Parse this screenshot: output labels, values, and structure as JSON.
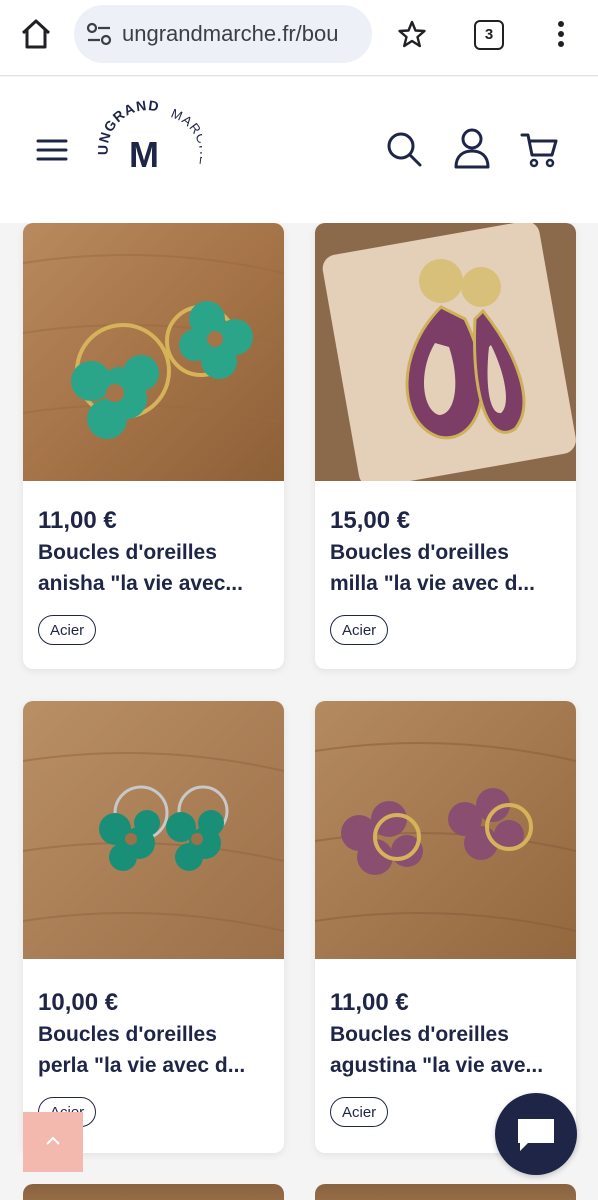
{
  "browser": {
    "url": "ungrandmarche.fr/bou",
    "tab_count": "3"
  },
  "brand": {
    "logo_top": "UNGRAND",
    "logo_side": "MARCHÉ",
    "logo_letter": "M",
    "primary_color": "#1f2547",
    "accent_color": "#f3b8ae"
  },
  "products": [
    {
      "price": "11,00 €",
      "name_line1": "Boucles d'oreilles",
      "name_line2": "anisha \"la vie avec...",
      "tag": "Acier",
      "image": "teal flower hoop earrings on wood"
    },
    {
      "price": "15,00 €",
      "name_line1": "Boucles d'oreilles",
      "name_line2": "milla \"la vie avec d...",
      "tag": "Acier",
      "image": "purple drop earrings with gold disc"
    },
    {
      "price": "10,00 €",
      "name_line1": "Boucles d'oreilles",
      "name_line2": "perla \"la vie avec d...",
      "tag": "Acier",
      "image": "green flower earrings on silver hoops"
    },
    {
      "price": "11,00 €",
      "name_line1": "Boucles d'oreilles",
      "name_line2": "agustina \"la vie ave...",
      "tag": "Acier",
      "image": "mauve flower earrings on gold hoops"
    }
  ],
  "icons": {
    "home": "home-icon",
    "tune": "site-info-icon",
    "star": "bookmark-star-icon",
    "kebab": "more-vertical-icon",
    "menu": "hamburger-menu-icon",
    "search": "search-icon",
    "account": "account-icon",
    "cart": "cart-icon",
    "chat": "chat-icon",
    "up": "chevron-up-icon"
  }
}
